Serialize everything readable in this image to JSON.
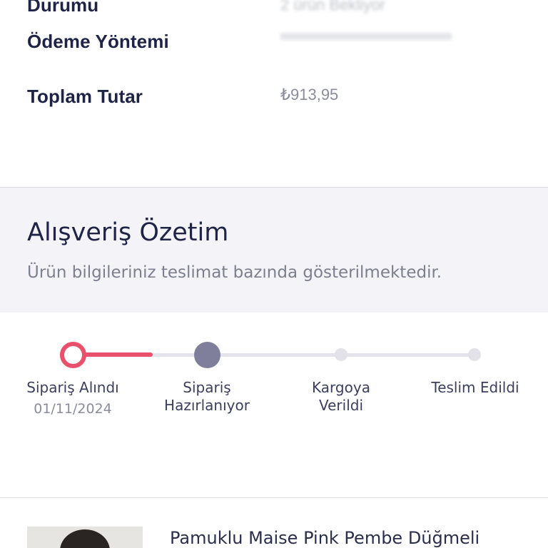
{
  "order_info": {
    "status_label": "Durumu",
    "status_value": "2 ürün Bekliyor",
    "payment_label": "Ödeme Yöntemi",
    "payment_value": "",
    "total_label": "Toplam Tutar",
    "total_value": "₺913,95"
  },
  "summary": {
    "title": "Alışveriş Özetim",
    "subtitle": "Ürün bilgileriniz teslimat bazında gösterilmektedir."
  },
  "tracker": {
    "progress_fraction": 0.2,
    "current_step": 2,
    "colors": {
      "done": "#e9506c",
      "active": "#7f7f9c",
      "pending": "#e2e2e8"
    },
    "steps": [
      {
        "line1": "Sipariş Alındı",
        "line2": "",
        "date": "01/11/2024"
      },
      {
        "line1": "Sipariş",
        "line2": "Hazırlanıyor",
        "date": ""
      },
      {
        "line1": "Kargoya",
        "line2": "Verildi",
        "date": ""
      },
      {
        "line1": "Teslim Edildi",
        "line2": "",
        "date": ""
      }
    ]
  },
  "product": {
    "title": "Pamuklu Maise Pink Pembe Düğmeli"
  }
}
